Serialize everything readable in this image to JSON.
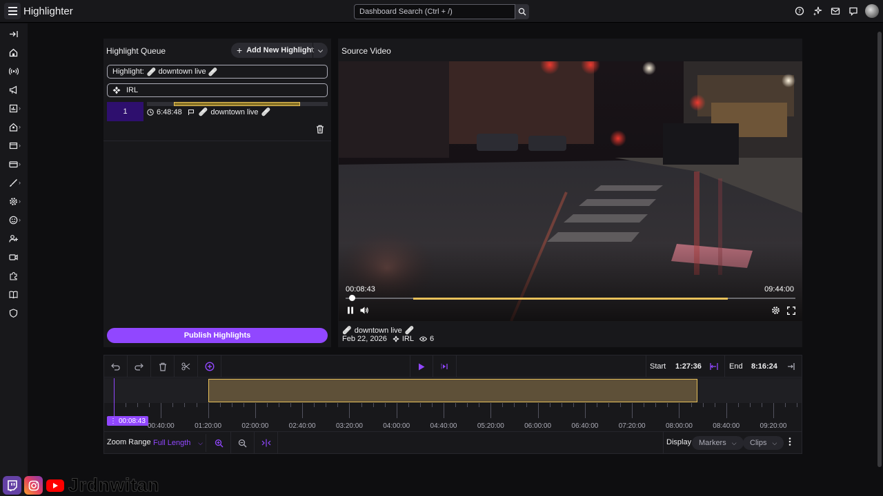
{
  "app": {
    "title": "Highlighter"
  },
  "search": {
    "placeholder": "Dashboard Search (Ctrl + /)"
  },
  "top_icons": [
    "help-icon",
    "sparkle-icon",
    "inbox-icon",
    "chat-icon",
    "user-avatar"
  ],
  "sidebar": {
    "items": [
      {
        "name": "collapse-icon",
        "chevron": false
      },
      {
        "name": "home-icon",
        "chevron": false
      },
      {
        "name": "stream-icon",
        "chevron": false
      },
      {
        "name": "megaphone-icon",
        "chevron": false
      },
      {
        "name": "analytics-icon",
        "chevron": true
      },
      {
        "name": "community-icon",
        "chevron": true
      },
      {
        "name": "content-icon",
        "chevron": true
      },
      {
        "name": "monetization-icon",
        "chevron": true
      },
      {
        "name": "brush-icon",
        "chevron": true
      },
      {
        "name": "settings-icon",
        "chevron": true
      },
      {
        "name": "emote-icon",
        "chevron": true
      },
      {
        "name": "add-user-icon",
        "chevron": false
      },
      {
        "name": "video-icon",
        "chevron": false
      },
      {
        "name": "puzzle-icon",
        "chevron": false
      },
      {
        "name": "book-icon",
        "chevron": false
      },
      {
        "name": "shield-icon",
        "chevron": false
      }
    ]
  },
  "queue": {
    "title": "Highlight Queue",
    "add_label": "Add New Highlight",
    "highlight_prefix": "Highlight:",
    "highlight_name": "downtown live",
    "category": "IRL",
    "items": [
      {
        "index": "1",
        "time": "6:48:48",
        "name": "downtown live"
      }
    ],
    "publish_label": "Publish Highlights"
  },
  "source": {
    "title": "Source Video",
    "current_time": "00:08:43",
    "duration": "09:44:00",
    "video_title": "downtown live",
    "date": "Feb 22, 2026",
    "category": "IRL",
    "views": "6",
    "progress_fraction": 0.015
  },
  "timeline": {
    "start_label": "Start",
    "start_value": "1:27:36",
    "end_label": "End",
    "end_value": "8:16:24",
    "playhead_time": "00:08:43",
    "tick_labels": [
      "00:40:00",
      "01:20:00",
      "02:00:00",
      "02:40:00",
      "03:20:00",
      "04:00:00",
      "04:40:00",
      "05:20:00",
      "06:00:00",
      "06:40:00",
      "07:20:00",
      "08:00:00",
      "08:40:00",
      "09:20:00"
    ],
    "zoom_label": "Zoom Range",
    "zoom_value": "Full Length",
    "display_label": "Display",
    "markers_label": "Markers",
    "clips_label": "Clips"
  },
  "colors": {
    "accent": "#9147ff",
    "clip": "#e8c15a",
    "background": "#0e0e10",
    "panel": "#18181b"
  },
  "brand": {
    "text": "Jrdnwitan"
  }
}
